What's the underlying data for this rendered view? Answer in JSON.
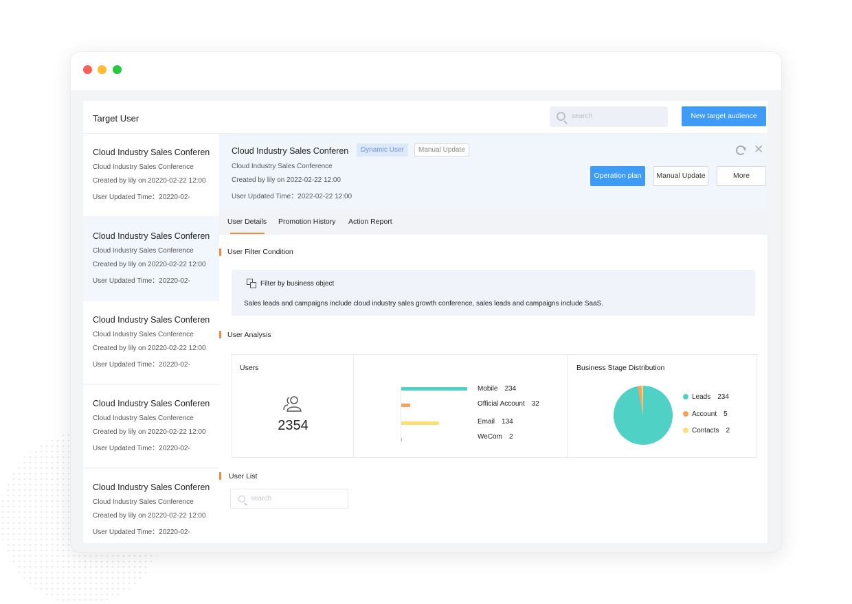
{
  "app": {
    "title": "Target User"
  },
  "top_search": {
    "placeholder": "search"
  },
  "new_button_label": "New target audience",
  "sidebar": {
    "items": [
      {
        "title": "Cloud Industry Sales Conferen",
        "subtitle": "Cloud Industry Sales Conference",
        "created": "Created by lily on 20220-02-22 12:00",
        "updated": "User Updated Time：20220-02-",
        "active": false
      },
      {
        "title": "Cloud Industry Sales Conferen",
        "subtitle": "Cloud Industry Sales Conference",
        "created": "Created by lily on 20220-02-22 12:00",
        "updated": "User Updated Time：20220-02-",
        "active": true
      },
      {
        "title": "Cloud Industry Sales Conferen",
        "subtitle": "Cloud Industry Sales Conference",
        "created": "Created by lily on 20220-02-22 12:00",
        "updated": "User Updated Time：20220-02-",
        "active": false
      },
      {
        "title": "Cloud Industry Sales Conferen",
        "subtitle": "Cloud Industry Sales Conference",
        "created": "Created by lily on 20220-02-22 12:00",
        "updated": "User Updated Time：20220-02-",
        "active": false
      },
      {
        "title": "Cloud Industry Sales Conferen",
        "subtitle": "Cloud Industry Sales Conference",
        "created": "Created by lily on 20220-02-22 12:00",
        "updated": "User Updated Time：20220-02-",
        "active": false
      }
    ]
  },
  "detail": {
    "title": "Cloud Industry Sales Conferen",
    "tag_dynamic": "Dynamic User",
    "tag_manual": "Manual Update",
    "subtitle": "Cloud Industry Sales Conference",
    "created": "Created by lily on 2022-02-22 12:00",
    "updated": "User Updated Time：2022-02-22 12:00",
    "buttons": {
      "operation_plan": "Operation plan",
      "manual_update": "Manual Update",
      "more": "More"
    },
    "tabs": [
      "User Details",
      "Promotion History",
      "Action Report"
    ],
    "active_tab": "User Details"
  },
  "filter_section": {
    "title": "User Filter Condition",
    "label": "Filter by business object",
    "condition": "Sales leads and campaigns include cloud industry sales growth conference, sales leads and campaigns include SaaS."
  },
  "analysis_section": {
    "title": "User  Analysis",
    "users_label": "Users",
    "users_count": "2354",
    "pie_title": "Business Stage Distribution"
  },
  "list_section": {
    "title": "User List",
    "search_placeholder": "search"
  },
  "colors": {
    "accent": "#3e9bf6",
    "orange": "#f5883a",
    "teal": "#4fd1c5",
    "yellow": "#fbe076"
  },
  "chart_data": [
    {
      "type": "bar",
      "orientation": "horizontal",
      "categories": [
        "Mobile",
        "Official Account",
        "Email",
        "WeCom"
      ],
      "values": [
        234,
        32,
        134,
        2
      ],
      "colors": [
        "#4fd1c5",
        "#f6a25b",
        "#fbe076",
        "#d9a2d9"
      ]
    },
    {
      "type": "pie",
      "title": "Business Stage Distribution",
      "categories": [
        "Leads",
        "Account",
        "Contacts"
      ],
      "values": [
        234,
        5,
        2
      ],
      "colors": [
        "#4fd1c5",
        "#f6a25b",
        "#fbe076"
      ]
    }
  ]
}
